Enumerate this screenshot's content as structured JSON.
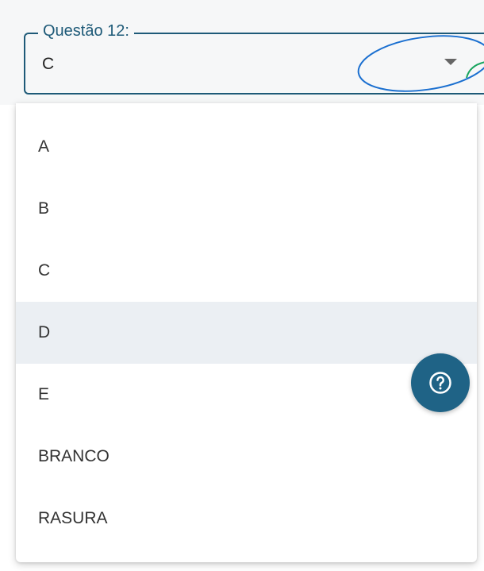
{
  "field": {
    "label": "Questão 12:",
    "value": "C"
  },
  "menu": {
    "options": [
      "A",
      "B",
      "C",
      "D",
      "E",
      "BRANCO",
      "RASURA"
    ],
    "highlighted": "D"
  },
  "help_button": {
    "icon": "help-circle-icon"
  },
  "colors": {
    "accent": "#1e5a78",
    "fab": "#1f6386",
    "hover": "#ebeff3",
    "annotation_blue": "#1a6fd0",
    "annotation_green": "#1aa560"
  }
}
